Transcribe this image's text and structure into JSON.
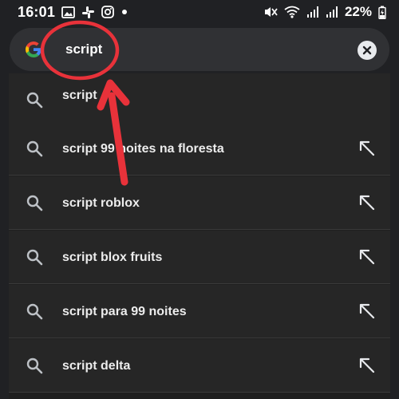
{
  "status_bar": {
    "time": "16:01",
    "battery_percent": "22%",
    "left_icons": [
      "gallery-icon",
      "slack-icon",
      "instagram-icon",
      "notification-dot-icon"
    ],
    "right_icons": [
      "mute-icon",
      "wifi-icon",
      "signal-icon",
      "signal-icon",
      "battery-charging-icon"
    ]
  },
  "search": {
    "query": "script",
    "logo_icon": "google-logo-icon",
    "clear_icon": "clear-icon"
  },
  "suggestions": [
    {
      "text": "script",
      "has_fill_arrow": false
    },
    {
      "text": "script 99 noites na floresta",
      "has_fill_arrow": true
    },
    {
      "text": "script roblox",
      "has_fill_arrow": true
    },
    {
      "text": "script blox fruits",
      "has_fill_arrow": true
    },
    {
      "text": "script para 99 noites",
      "has_fill_arrow": true
    },
    {
      "text": "script delta",
      "has_fill_arrow": true
    }
  ],
  "colors": {
    "background": "#202124",
    "search_bar": "#303134",
    "row": "#262626",
    "annotation_red": "#e8323a"
  }
}
